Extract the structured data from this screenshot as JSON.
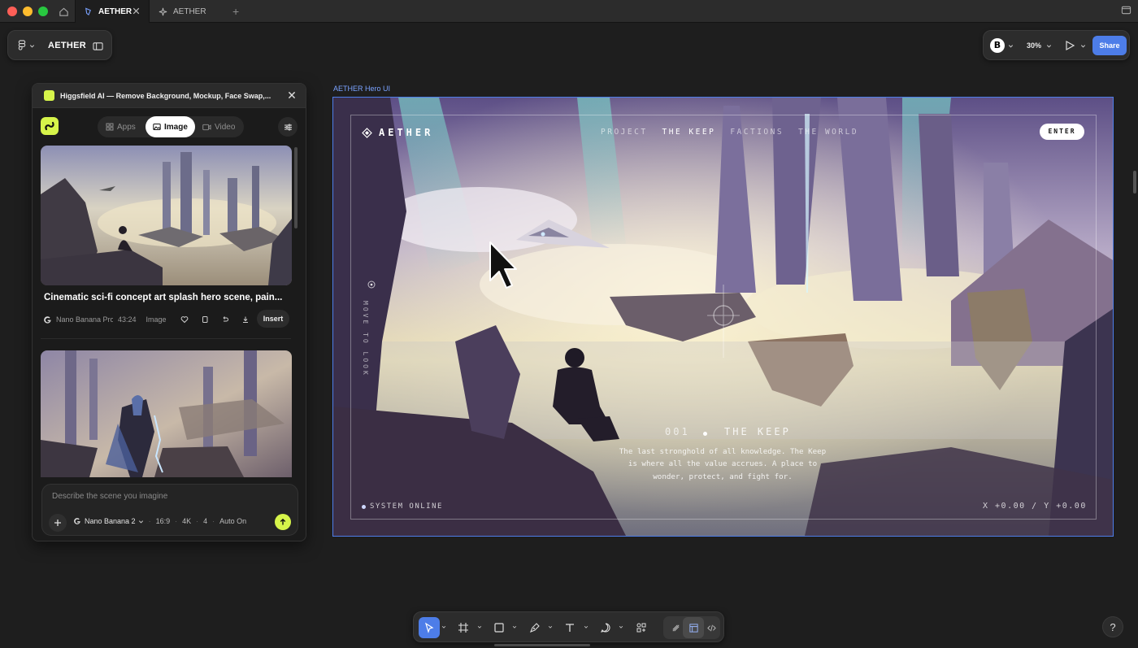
{
  "titlebar": {
    "tabs": [
      {
        "label": "AETHER",
        "active": true
      },
      {
        "label": "AETHER",
        "active": false
      }
    ]
  },
  "toolbar": {
    "file_title": "AETHER",
    "avatar_initial": "B",
    "zoom": "30%",
    "share_label": "Share"
  },
  "plugin": {
    "title": "Higgsfield AI — Remove Background, Mockup, Face Swap,...",
    "tabs": [
      "Apps",
      "Image",
      "Video"
    ],
    "selected_tab": "Image",
    "cards": [
      {
        "title": "Cinematic sci-fi concept art splash hero scene, pain...",
        "model": "Nano Banana Pro",
        "time": "43:24",
        "kind": "Image",
        "insert_label": "Insert"
      }
    ],
    "prompt_placeholder": "Describe the scene you imagine",
    "prompt_options": {
      "model": "Nano Banana 2",
      "ratio": "16:9",
      "resolution": "4K",
      "count": "4",
      "auto": "Auto On"
    }
  },
  "frame": {
    "label": "AETHER Hero UI",
    "brand": "AETHER",
    "nav": [
      "PROJECT",
      "THE KEEP",
      "FACTIONS",
      "THE WORLD"
    ],
    "nav_current": "THE KEEP",
    "enter_label": "ENTER",
    "side_text": "MOVE TO LOOK",
    "section_number": "001",
    "section_name": "THE KEEP",
    "description": "The last stronghold of all knowledge. The Keep is where all the value accrues. A place to wonder, protect, and fight for.",
    "status": "SYSTEM ONLINE",
    "coords": "X +0.00 / Y +0.00"
  },
  "help_label": "?",
  "colors": {
    "accent": "#4d7de8",
    "plugin_brand": "#d6f44a",
    "bg": "#1e1e1e"
  }
}
